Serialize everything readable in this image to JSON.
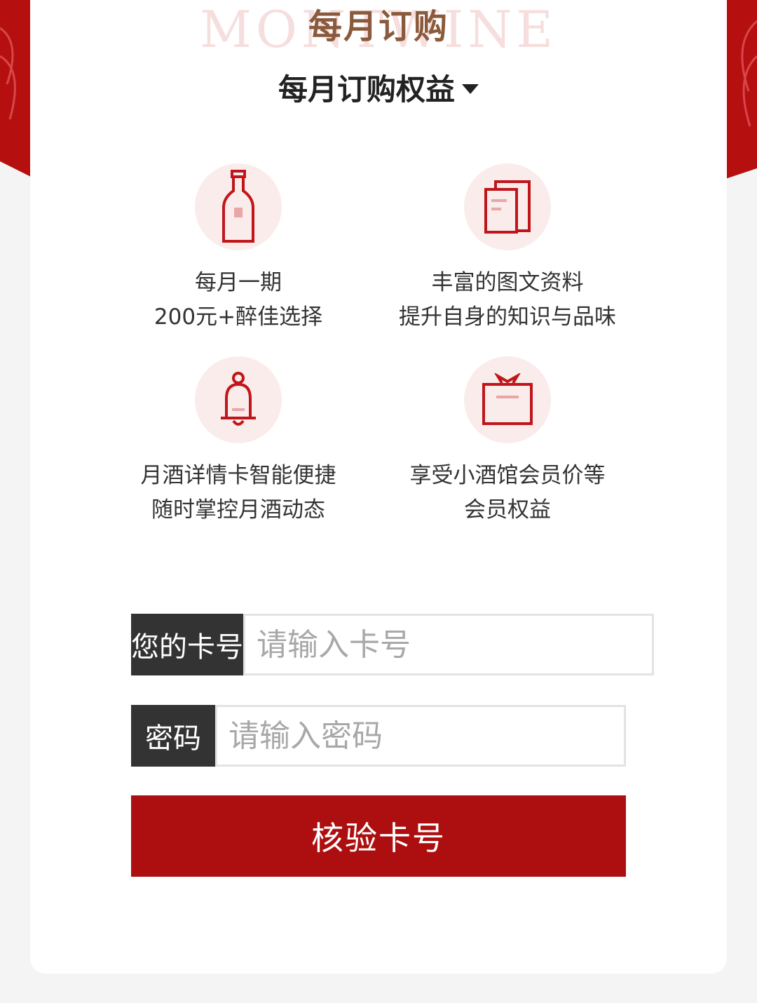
{
  "header": {
    "logo_watermark": "MONTWINE",
    "logo_title": "每月订购",
    "section_title": "每月订购权益"
  },
  "benefits": [
    {
      "icon": "wine-bottle-icon",
      "line1": "每月一期",
      "line2": "200元+醉佳选择"
    },
    {
      "icon": "documents-icon",
      "line1": "丰富的图文资料",
      "line2": "提升自身的知识与品味"
    },
    {
      "icon": "bell-icon",
      "line1": "月酒详情卡智能便捷",
      "line2": "随时掌控月酒动态"
    },
    {
      "icon": "gift-box-icon",
      "line1": "享受小酒馆会员价等",
      "line2": "会员权益"
    }
  ],
  "form": {
    "card_label": "您的卡号",
    "card_placeholder": "请输入卡号",
    "password_label": "密码",
    "password_placeholder": "请输入密码",
    "submit_label": "核验卡号"
  },
  "colors": {
    "brand_red": "#ad0f10",
    "icon_bg": "#faeceb",
    "label_bg": "#333333"
  }
}
